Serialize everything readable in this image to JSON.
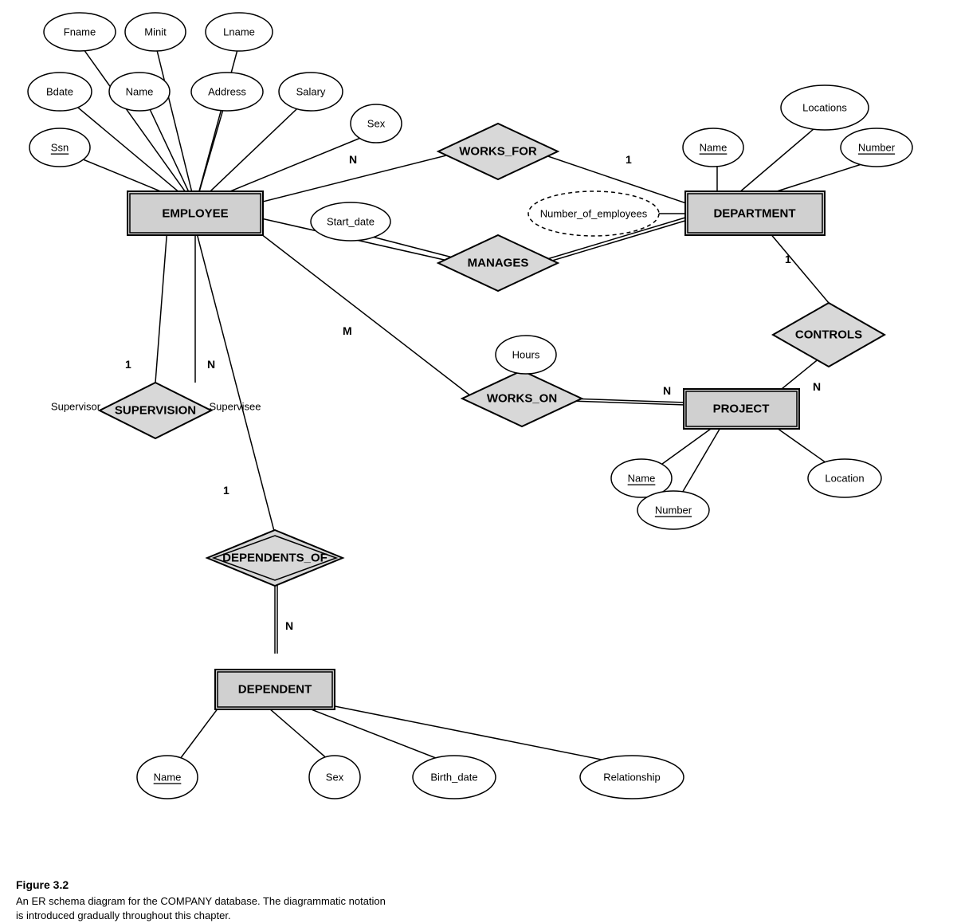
{
  "caption": {
    "title": "Figure 3.2",
    "line1": "An ER schema diagram for the COMPANY database. The diagrammatic notation",
    "line2": "is introduced gradually throughout this chapter."
  },
  "entities": {
    "employee": "EMPLOYEE",
    "department": "DEPARTMENT",
    "project": "PROJECT",
    "dependent": "DEPENDENT"
  },
  "relationships": {
    "works_for": "WORKS_FOR",
    "manages": "MANAGES",
    "works_on": "WORKS_ON",
    "controls": "CONTROLS",
    "supervision": "SUPERVISION",
    "dependents_of": "DEPENDENTS_OF"
  },
  "attributes": {
    "fname": "Fname",
    "minit": "Minit",
    "lname": "Lname",
    "bdate": "Bdate",
    "name_emp": "Name",
    "address": "Address",
    "salary": "Salary",
    "ssn": "Ssn",
    "sex_emp": "Sex",
    "start_date": "Start_date",
    "number_of_employees": "Number_of_employees",
    "locations": "Locations",
    "dept_name": "Name",
    "dept_number": "Number",
    "hours": "Hours",
    "proj_name": "Name",
    "proj_number": "Number",
    "location": "Location",
    "dep_name": "Name",
    "dep_sex": "Sex",
    "birth_date": "Birth_date",
    "relationship": "Relationship"
  },
  "cardinality": {
    "n": "N",
    "m": "M",
    "one": "1"
  }
}
